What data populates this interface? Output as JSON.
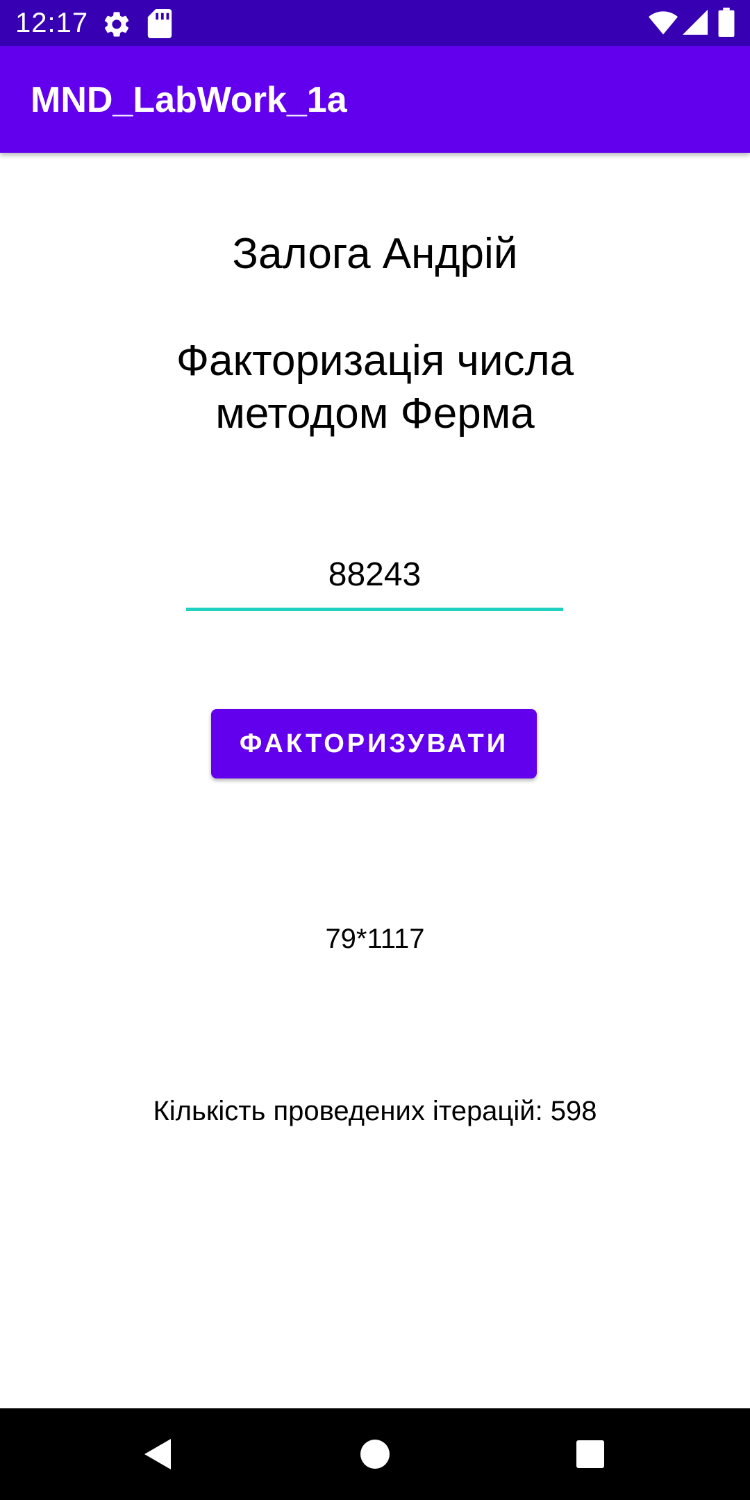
{
  "status_bar": {
    "time": "12:17",
    "background_color": "#3700b3",
    "left_icons": [
      "gear-icon",
      "sd-card-icon"
    ],
    "right_icons": [
      "wifi-icon",
      "cellular-signal-icon",
      "battery-icon"
    ]
  },
  "app_bar": {
    "title": "MND_LabWork_1a",
    "background_color": "#6200ee"
  },
  "main": {
    "author": "Залога Андрій",
    "topic_line_1": "Факторизація числа",
    "topic_line_2": "методом Ферма",
    "number_input_value": "88243",
    "input_underline_color": "#1fd1c0",
    "factorize_button_label": "ФАКТОРИЗУВАТИ",
    "button_color": "#6200ee",
    "result": "79*1117",
    "iterations": "Кількість проведених ітерацій: 598"
  },
  "nav_bar": {
    "buttons": [
      "back-icon",
      "home-icon",
      "recents-icon"
    ]
  }
}
